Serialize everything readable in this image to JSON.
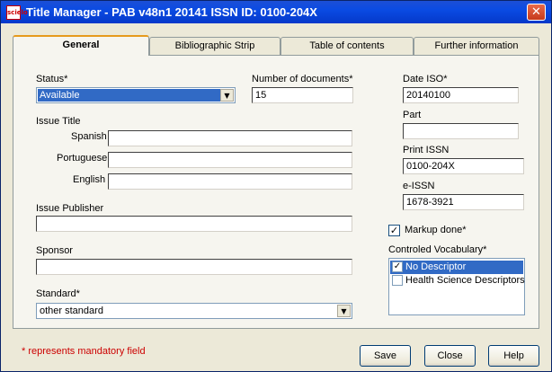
{
  "window": {
    "title": "Title Manager - PAB v48n1 20141 ISSN ID: 0100-204X",
    "icon_text": "scielo",
    "close_glyph": "✕"
  },
  "tabs": [
    {
      "label": "General",
      "active": true
    },
    {
      "label": "Bibliographic Strip",
      "active": false
    },
    {
      "label": "Table of contents",
      "active": false
    },
    {
      "label": "Further information",
      "active": false
    }
  ],
  "general": {
    "status_label": "Status*",
    "status_value": "Available",
    "num_docs_label": "Number of documents*",
    "num_docs_value": "15",
    "date_iso_label": "Date ISO*",
    "date_iso_value": "20140100",
    "part_label": "Part",
    "part_value": "",
    "issue_title_label": "Issue Title",
    "spanish_label": "Spanish",
    "spanish_value": "",
    "portuguese_label": "Portuguese",
    "portuguese_value": "",
    "english_label": "English",
    "english_value": "",
    "print_issn_label": "Print ISSN",
    "print_issn_value": "0100-204X",
    "eissn_label": "e-ISSN",
    "eissn_value": "1678-3921",
    "issue_publisher_label": "Issue Publisher",
    "issue_publisher_value": "",
    "markup_done_label": "Markup done*",
    "markup_done_checked": true,
    "sponsor_label": "Sponsor",
    "sponsor_value": "",
    "controlled_vocab_label": "Controled Vocabulary*",
    "vocab_options": [
      {
        "label": "No Descriptor",
        "checked": true,
        "selected": true
      },
      {
        "label": "Health Science Descriptors",
        "checked": false,
        "selected": false
      }
    ],
    "standard_label": "Standard*",
    "standard_value": "other standard"
  },
  "footer": {
    "note": "* represents mandatory field",
    "save_label": "Save",
    "close_label": "Close",
    "help_label": "Help"
  },
  "glyphs": {
    "check": "✓",
    "dropdown": "▼"
  }
}
